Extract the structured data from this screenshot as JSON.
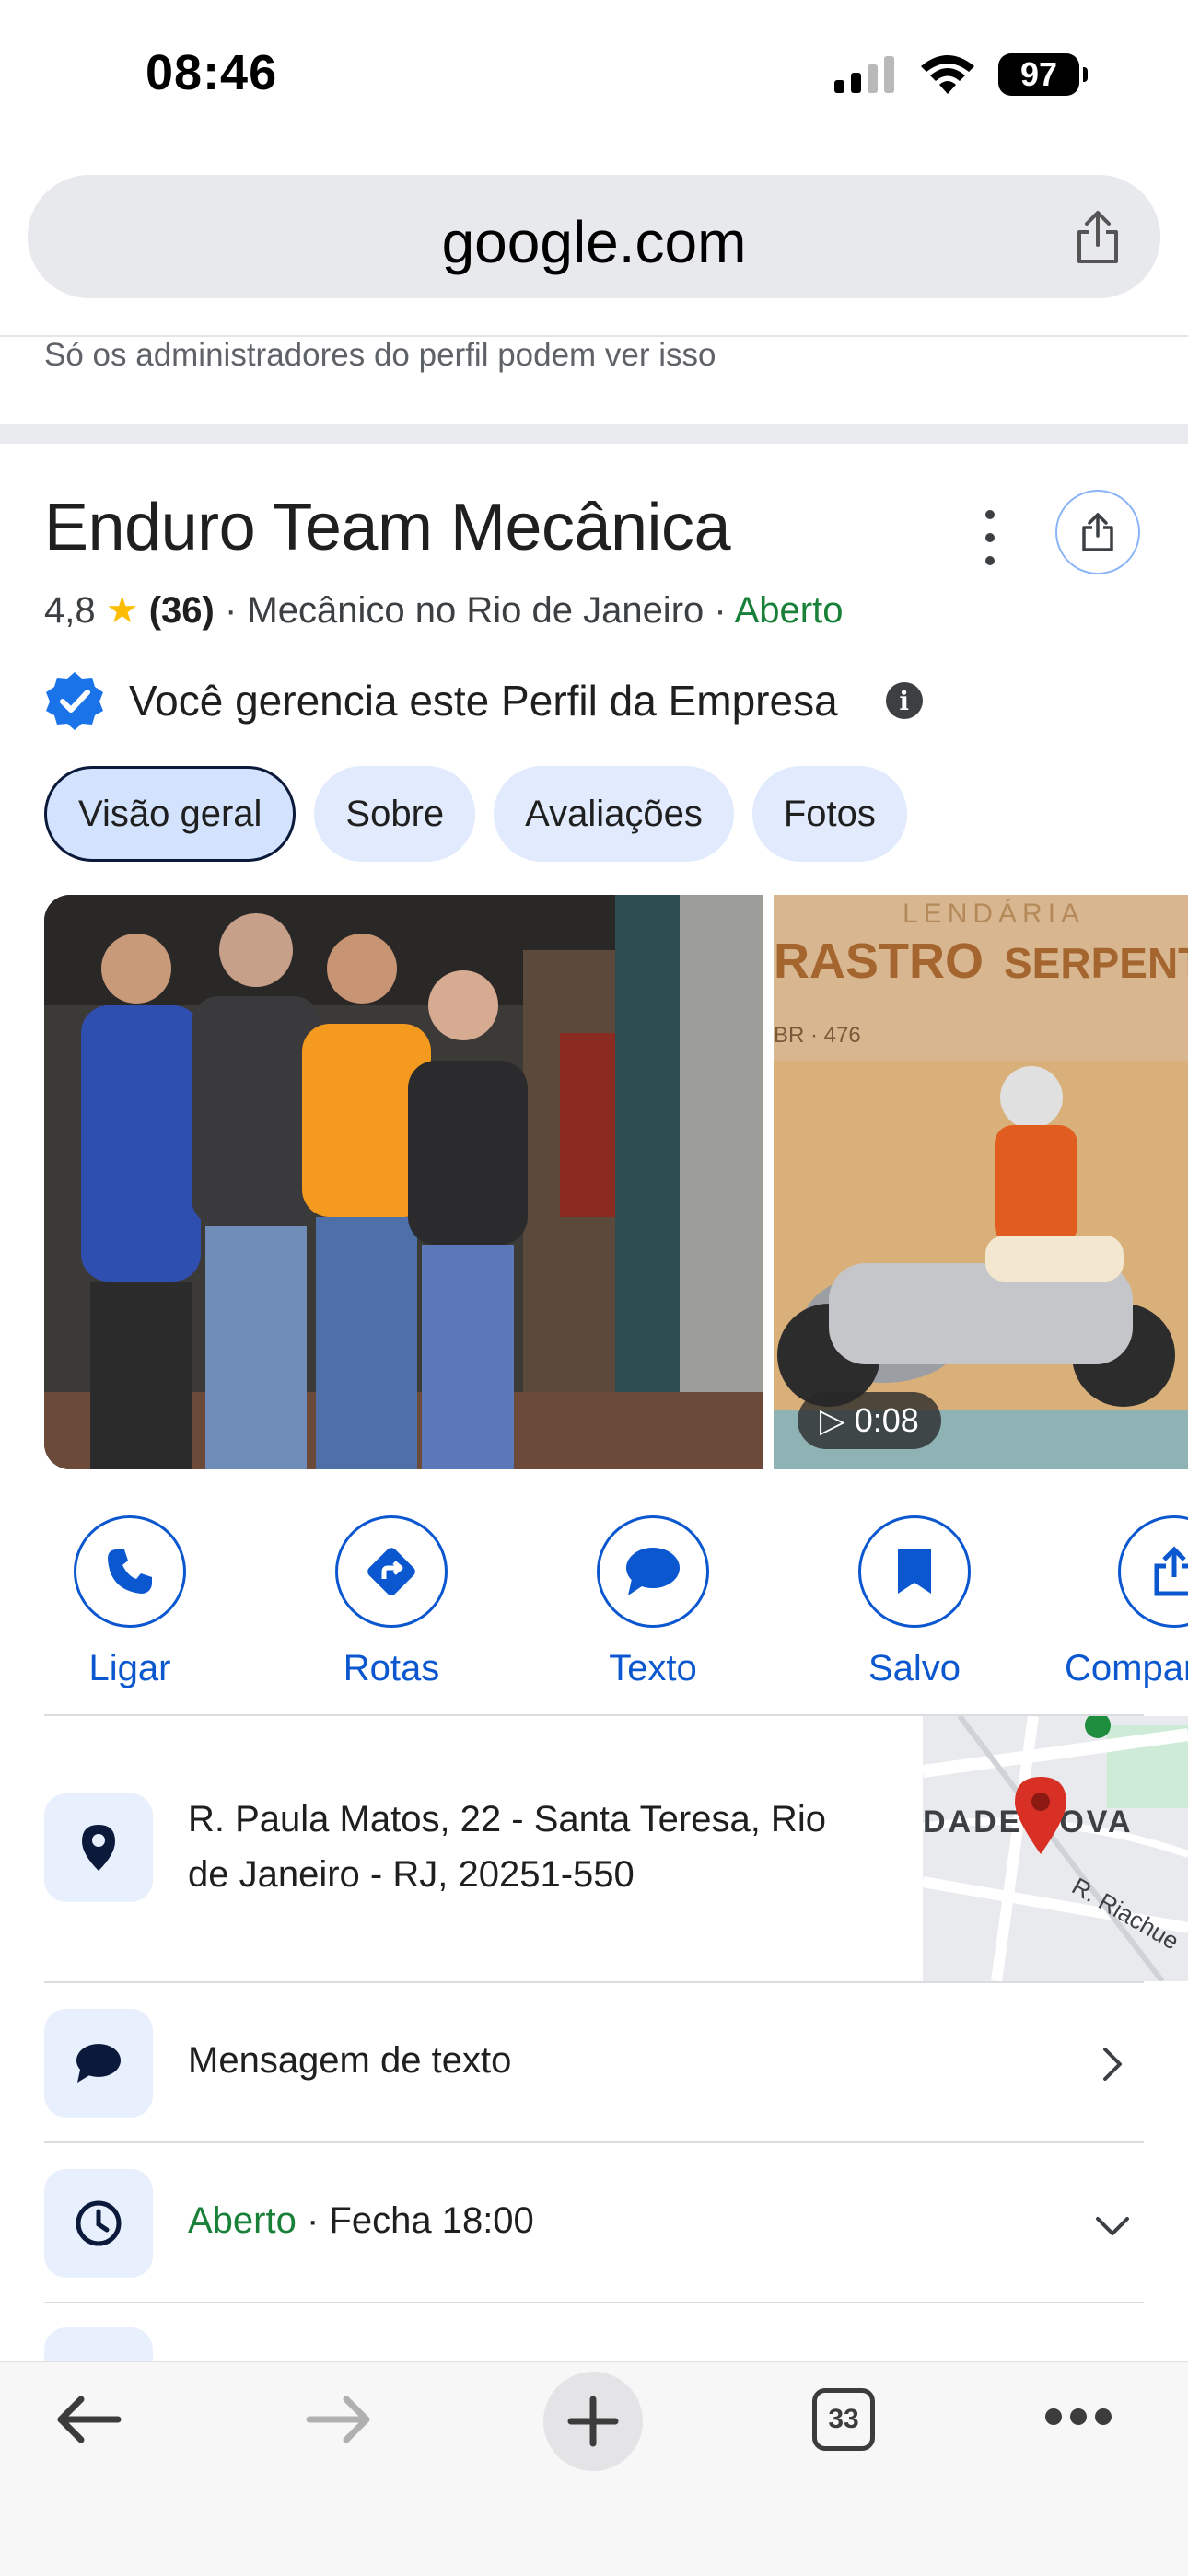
{
  "status_bar": {
    "time": "08:46",
    "battery": "97"
  },
  "browser": {
    "url": "google.com",
    "tab_count": "33"
  },
  "admin_note": "Só os administradores do perfil podem ver isso",
  "business": {
    "name": "Enduro Team Mecânica",
    "rating": "4,8",
    "reviews": "(36)",
    "category": "Mecânico no Rio de Janeiro",
    "status": "Aberto",
    "verified_text": "Você gerencia este Perfil da Empresa"
  },
  "tabs": [
    {
      "label": "Visão geral"
    },
    {
      "label": "Sobre"
    },
    {
      "label": "Avaliações"
    },
    {
      "label": "Fotos"
    }
  ],
  "photos": {
    "video_duration": "0:08"
  },
  "actions": [
    {
      "label": "Ligar",
      "icon": "phone-icon"
    },
    {
      "label": "Rotas",
      "icon": "directions-icon"
    },
    {
      "label": "Texto",
      "icon": "chat-icon"
    },
    {
      "label": "Salvo",
      "icon": "bookmark-icon"
    },
    {
      "label": "Compar",
      "icon": "share-icon"
    }
  ],
  "address": "R. Paula Matos, 22 - Santa Teresa, Rio de Janeiro - RJ, 20251-550",
  "map_labels": {
    "district": "DADE NOVA",
    "street": "R. Riachue"
  },
  "message_row": {
    "label": "Mensagem de texto"
  },
  "hours_row": {
    "status": "Aberto",
    "closes": "· Fecha 18:00"
  },
  "colors": {
    "accent": "#0b57d0",
    "open_green": "#188038",
    "star": "#fbbc04",
    "chip_bg": "#e1ebfd"
  }
}
